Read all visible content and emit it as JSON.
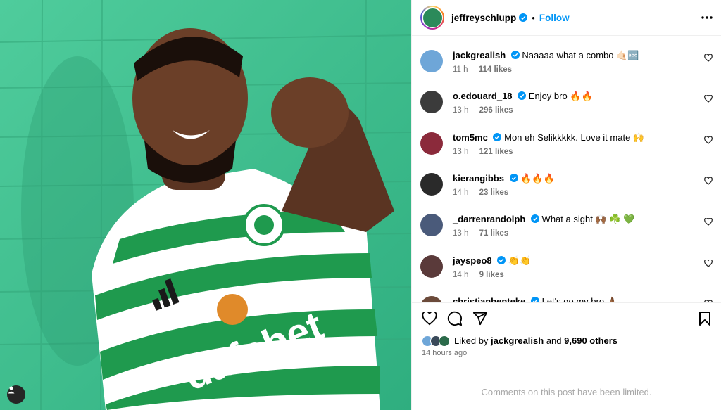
{
  "post": {
    "author": "jeffreyschlupp",
    "follow_label": "Follow",
    "dot": "•",
    "jersey_sponsor": "dafabet"
  },
  "comments": [
    {
      "user": "jackgrealish",
      "text": "Naaaaa what a combo 🤙🏻🔤",
      "time": "11 h",
      "likes": "114 likes",
      "avatar_color": "#6ea6d8"
    },
    {
      "user": "o.edouard_18",
      "text": "Enjoy bro 🔥🔥",
      "time": "13 h",
      "likes": "296 likes",
      "avatar_color": "#3b3b3b"
    },
    {
      "user": "tom5mc",
      "text": "Mon eh Selikkkkk. Love it mate 🙌",
      "time": "13 h",
      "likes": "121 likes",
      "avatar_color": "#8b2a3b"
    },
    {
      "user": "kierangibbs",
      "text": "🔥🔥🔥",
      "time": "14 h",
      "likes": "23 likes",
      "avatar_color": "#2a2a2a"
    },
    {
      "user": "_darrenrandolph",
      "text": "What a sight 🙌🏾 ☘️ 💚",
      "time": "13 h",
      "likes": "71 likes",
      "avatar_color": "#4a5a7a"
    },
    {
      "user": "jayspeo8",
      "text": "👏👏",
      "time": "14 h",
      "likes": "9 likes",
      "avatar_color": "#5a3a3a"
    },
    {
      "user": "christianbenteke",
      "text": "Let's go my bro 🙏🏾",
      "time": "",
      "likes": "",
      "avatar_color": "#6b4a3a"
    }
  ],
  "likes": {
    "prefix": "Liked by",
    "user": "jackgrealish",
    "and": "and",
    "others": "9,690 others"
  },
  "timestamp": "14 hours ago",
  "limited_notice": "Comments on this post have been limited.",
  "colors": {
    "accent": "#0095f6",
    "wall": "#3dbf8e",
    "muted": "#737373"
  }
}
